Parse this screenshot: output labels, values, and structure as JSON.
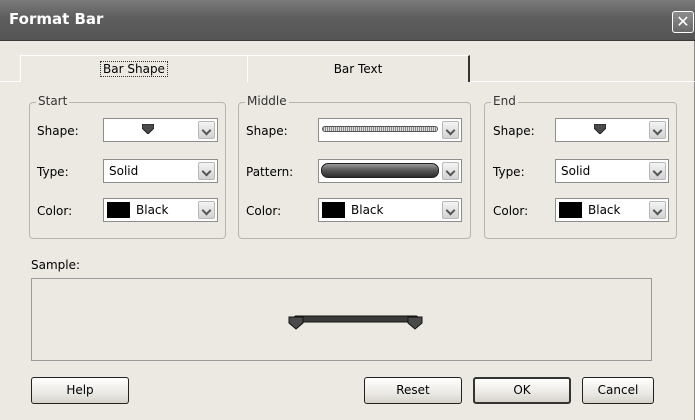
{
  "window": {
    "title": "Format Bar"
  },
  "tabs": [
    {
      "label": "Bar Shape",
      "active": true
    },
    {
      "label": "Bar Text",
      "active": false
    }
  ],
  "start": {
    "title": "Start",
    "shape_label": "Shape:",
    "shape_value": "down-triangle-marker",
    "type_label": "Type:",
    "type_value": "Solid",
    "color_label": "Color:",
    "color_value": "Black",
    "color_hex": "#000000"
  },
  "middle": {
    "title": "Middle",
    "shape_label": "Shape:",
    "shape_value": "thin-hatched-bar",
    "pattern_label": "Pattern:",
    "pattern_value": "solid-shaded-bar",
    "color_label": "Color:",
    "color_value": "Black",
    "color_hex": "#000000"
  },
  "end": {
    "title": "End",
    "shape_label": "Shape:",
    "shape_value": "down-triangle-marker",
    "type_label": "Type:",
    "type_value": "Solid",
    "color_label": "Color:",
    "color_value": "Black",
    "color_hex": "#000000"
  },
  "sample": {
    "label": "Sample:"
  },
  "buttons": {
    "help": "Help",
    "reset": "Reset",
    "ok": "OK",
    "cancel": "Cancel"
  },
  "icons": {
    "close": "close-icon",
    "dropdown": "chevron-down-icon",
    "marker": "down-triangle-marker-icon"
  }
}
